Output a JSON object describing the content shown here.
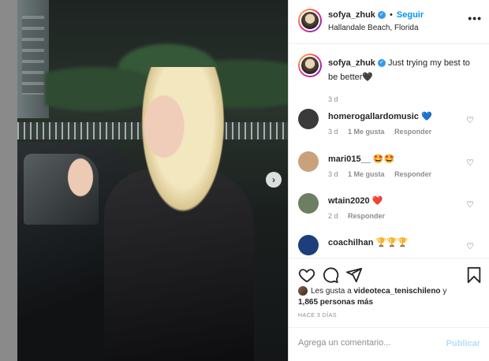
{
  "post": {
    "username": "sofya_zhuk",
    "follow_label": "Seguir",
    "separator": "•",
    "location": "Hallandale Beach, Florida",
    "more_label": "•••",
    "caption": "Just trying my best to be better🖤",
    "caption_time": "3 d"
  },
  "comments": [
    {
      "username": "homerogallardomusic",
      "text": "💙",
      "time": "3 d",
      "likes": "1 Me gusta",
      "reply": "Responder",
      "avatar_color": "#3a3a3a"
    },
    {
      "username": "mari015__",
      "text": "🤩🤩",
      "time": "3 d",
      "likes": "1 Me gusta",
      "reply": "Responder",
      "avatar_color": "#c9a27c"
    },
    {
      "username": "wtain2020",
      "text": "❤️",
      "time": "2 d",
      "likes": "",
      "reply": "Responder",
      "avatar_color": "#6d7e63"
    },
    {
      "username": "coachilhan",
      "text": "🏆🏆🏆",
      "time": "",
      "likes": "",
      "reply": "",
      "avatar_color": "#1c3e7a"
    }
  ],
  "footer": {
    "liked_by_prefix": "Les gusta a",
    "liked_by_user": "videoteca_tenischileno",
    "liked_by_and": "y",
    "liked_by_count": "1,865 personas más",
    "time_ago": "HACE 3 DÍAS",
    "comment_placeholder": "Agrega un comentario...",
    "publish_label": "Publicar"
  },
  "icons": {
    "heart": "heart-icon",
    "comment": "comment-icon",
    "share": "share-icon",
    "save": "bookmark-icon",
    "next": "chevron-right-icon"
  },
  "colors": {
    "accent": "#0095f6",
    "verified": "#3897f0",
    "muted": "#8e8e8e"
  }
}
